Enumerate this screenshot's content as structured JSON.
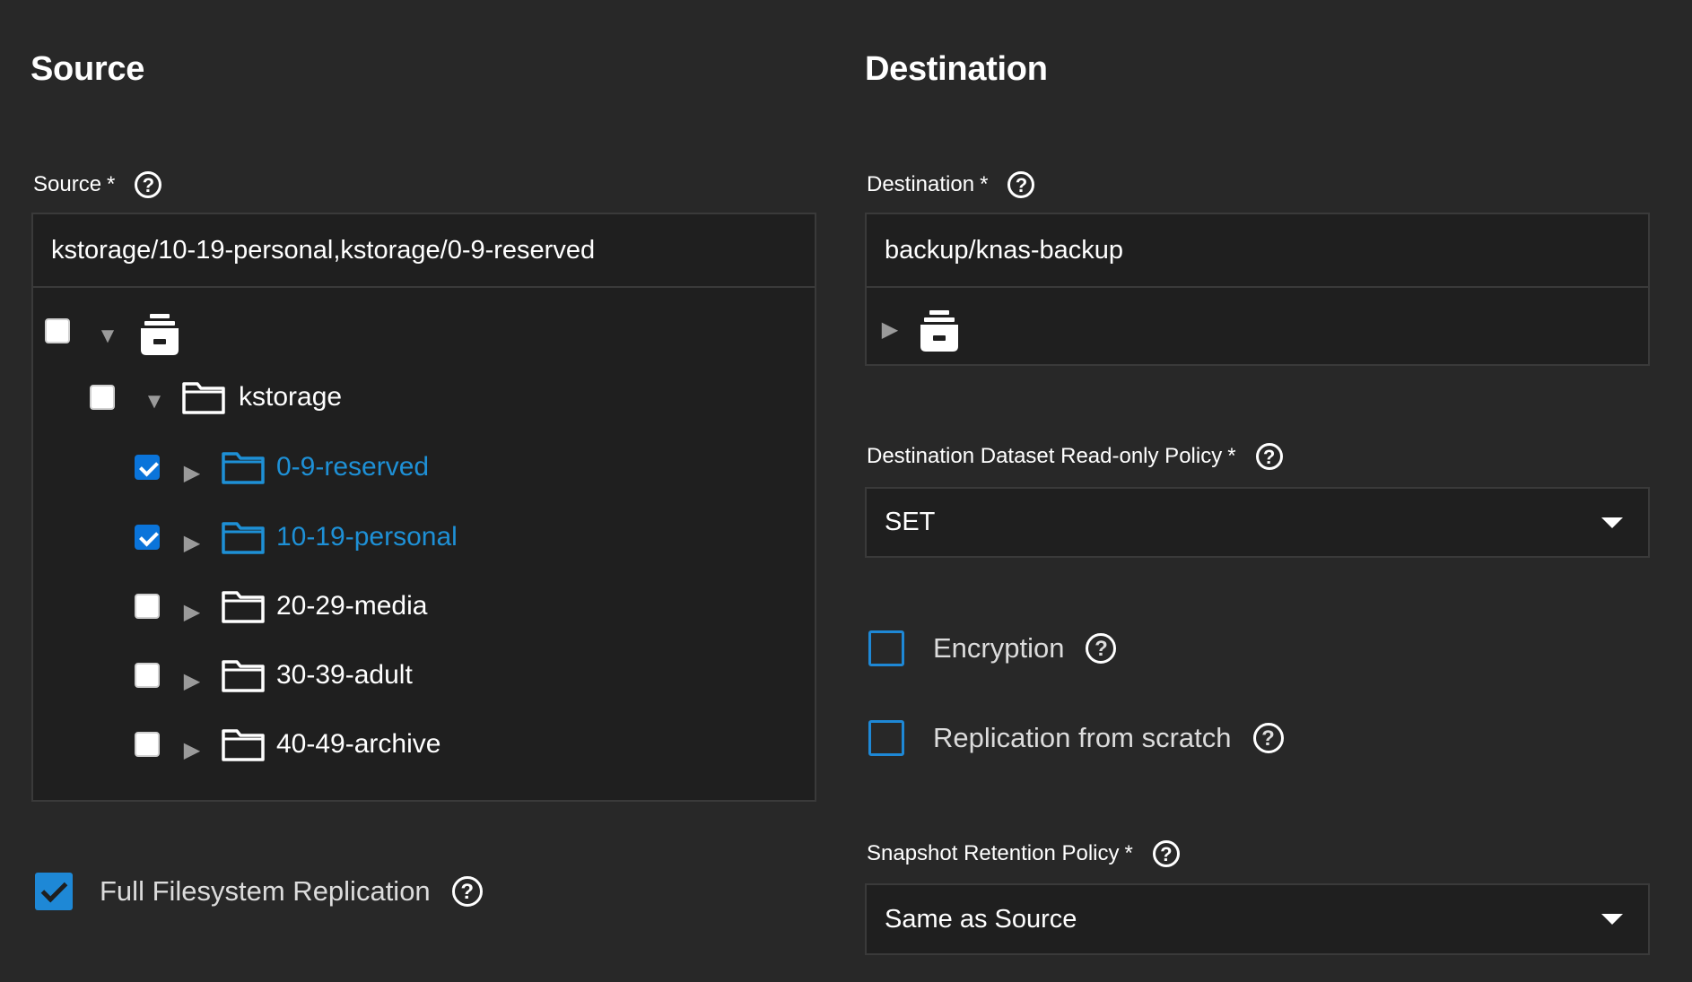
{
  "source": {
    "heading": "Source",
    "field_label": "Source",
    "required_mark": "*",
    "value": "kstorage/10-19-personal,kstorage/0-9-reserved",
    "tree": {
      "pool": "kstorage",
      "children": [
        {
          "label": "0-9-reserved",
          "checked": true
        },
        {
          "label": "10-19-personal",
          "checked": true
        },
        {
          "label": "20-29-media",
          "checked": false
        },
        {
          "label": "30-39-adult",
          "checked": false
        },
        {
          "label": "40-49-archive",
          "checked": false
        }
      ]
    },
    "full_fs_label": "Full Filesystem Replication"
  },
  "destination": {
    "heading": "Destination",
    "field_label": "Destination",
    "required_mark": "*",
    "value": "backup/knas-backup",
    "readonly_label": "Destination Dataset Read-only Policy",
    "readonly_value": "SET",
    "encryption_label": "Encryption",
    "scratch_label": "Replication from scratch",
    "retention_label": "Snapshot Retention Policy",
    "retention_value": "Same as Source"
  },
  "icons": {
    "help": "?",
    "expanded": "▼",
    "collapsed": "▶"
  },
  "colors": {
    "background": "#282828",
    "input_bg": "#1f1f1f",
    "accent": "#1e88d6",
    "selected_text": "#1e90d6"
  }
}
